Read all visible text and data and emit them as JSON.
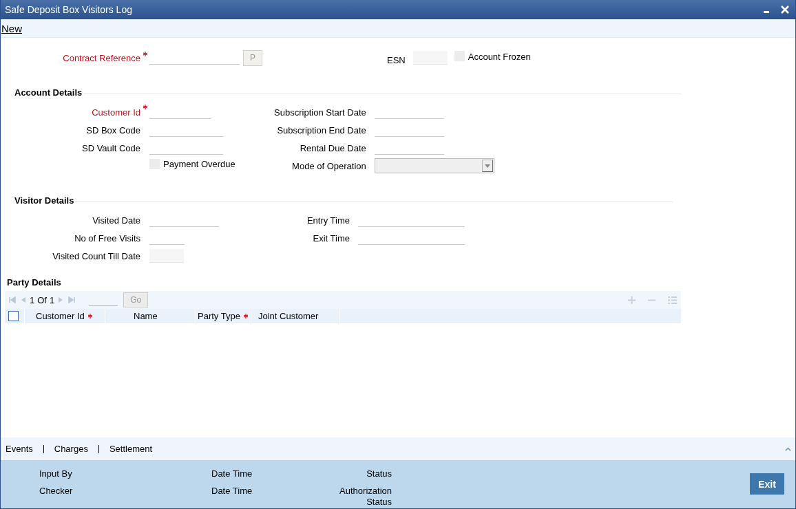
{
  "window": {
    "title": "Safe Deposit Box Visitors Log"
  },
  "toolbar": [
    {
      "label": "New"
    }
  ],
  "header": {
    "contract_reference": {
      "label": "Contract Reference",
      "required": true
    },
    "lookup_button": "P",
    "esn": {
      "label": "ESN"
    },
    "account_frozen": {
      "label": "Account Frozen",
      "checked": false
    }
  },
  "sections": [
    {
      "title": "Account Details",
      "left": [
        {
          "kind": "text",
          "label": "Customer Id",
          "required": true
        },
        {
          "kind": "text",
          "label": "SD Box Code",
          "required": false
        },
        {
          "kind": "text",
          "label": "SD Vault Code",
          "required": false
        },
        {
          "kind": "checkbox",
          "label": "Payment Overdue",
          "checked": false
        }
      ],
      "right": [
        {
          "kind": "text",
          "label": "Subscription Start Date",
          "required": false
        },
        {
          "kind": "text",
          "label": "Subscription End Date",
          "required": false
        },
        {
          "kind": "text",
          "label": "Rental Due Date",
          "required": false
        },
        {
          "kind": "select",
          "label": "Mode of Operation",
          "required": false
        }
      ]
    },
    {
      "title": "Visitor Details",
      "left": [
        {
          "kind": "text",
          "label": "Visited Date",
          "required": false
        },
        {
          "kind": "text",
          "label": "No of Free Visits",
          "required": false
        },
        {
          "kind": "readonly",
          "label": "Visited Count Till Date",
          "required": false
        }
      ],
      "right": [
        {
          "kind": "text",
          "label": "Entry Time",
          "required": false
        },
        {
          "kind": "text",
          "label": "Exit Time",
          "required": false
        }
      ]
    }
  ],
  "party_details": {
    "title": "Party Details",
    "page": "1",
    "of_label": "Of",
    "pages": "1",
    "go_button": "Go",
    "select_all": {
      "checked": false
    },
    "columns": [
      {
        "label": "Customer Id",
        "required": true
      },
      {
        "label": "Name",
        "required": false
      },
      {
        "label": "Party Type",
        "required": true
      },
      {
        "label": "Joint Customer",
        "required": false
      }
    ]
  },
  "bottom_tabs": [
    {
      "label": "Events"
    },
    {
      "label": "Charges"
    },
    {
      "label": "Settlement"
    }
  ],
  "footer": {
    "rows": [
      [
        "Input By",
        "Date Time",
        "Status"
      ],
      [
        "Checker",
        "Date Time",
        "Authorization Status"
      ]
    ],
    "exit_button": "Exit"
  }
}
